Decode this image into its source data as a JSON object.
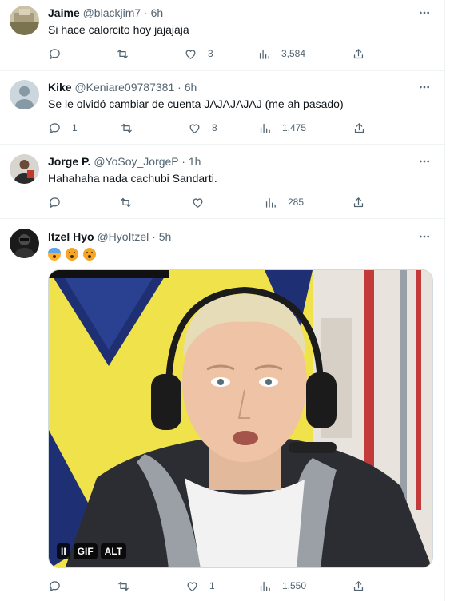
{
  "tweets": [
    {
      "name": "Jaime",
      "handle": "@blackjim7",
      "dot": "·",
      "time": "6h",
      "text": "Si hace calorcito hoy jajajaja",
      "replies": "",
      "retweets": "",
      "likes": "3",
      "views": "3,584"
    },
    {
      "name": "Kike",
      "handle": "@Keniare09787381",
      "dot": "·",
      "time": "6h",
      "text": "Se le olvidó cambiar de cuenta JAJAJAJAJ (me ah pasado)",
      "replies": "1",
      "retweets": "",
      "likes": "8",
      "views": "1,475"
    },
    {
      "name": "Jorge P.",
      "handle": "@YoSoy_JorgeP",
      "dot": "·",
      "time": "1h",
      "text": "Hahahaha nada cachubi Sandarti.",
      "replies": "",
      "retweets": "",
      "likes": "",
      "views": "285"
    },
    {
      "name": "Itzel Hyo",
      "handle": "@HyoItzel",
      "dot": "·",
      "time": "5h",
      "emojis": [
        "face-screaming-in-fear",
        "face-with-hand-over-mouth",
        "face-with-hand-over-mouth"
      ],
      "replies": "",
      "retweets": "",
      "likes": "1",
      "views": "1,550",
      "media": {
        "type": "gif",
        "pause_label": "II",
        "gif_label": "GIF",
        "alt_label": "ALT"
      }
    }
  ],
  "colors": {
    "text": "#0f1419",
    "secondary": "#536471",
    "divider": "#eff3f4"
  },
  "icons": [
    "more-icon",
    "reply-icon",
    "retweet-icon",
    "like-icon",
    "views-icon",
    "share-icon"
  ]
}
